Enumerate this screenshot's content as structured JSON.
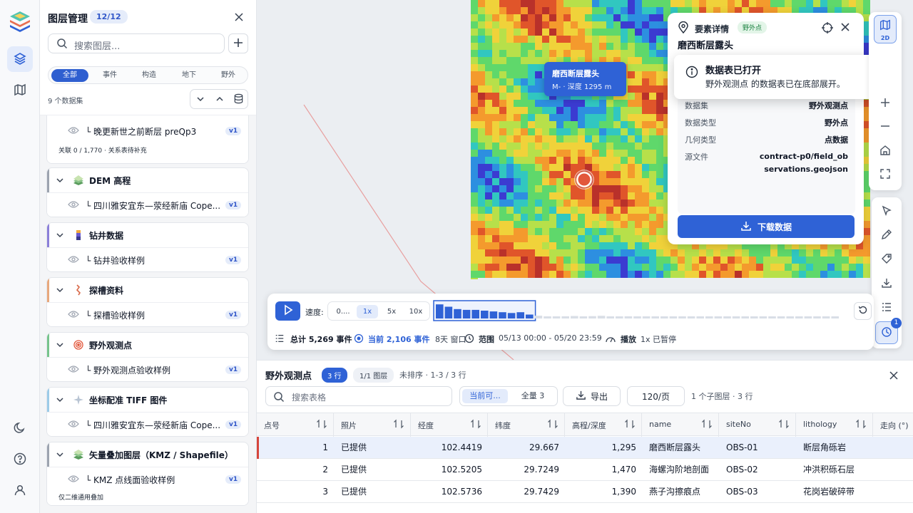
{
  "rail": {
    "items": [
      {
        "name": "layers-icon",
        "active": true
      },
      {
        "name": "map-icon",
        "active": false
      },
      {
        "name": "moon-icon",
        "active": false
      },
      {
        "name": "help-icon",
        "active": false
      },
      {
        "name": "user-icon",
        "active": false
      }
    ]
  },
  "layer_panel": {
    "title": "图层管理",
    "count": "12/12",
    "search_placeholder": "搜索图层...",
    "filters": [
      "全部",
      "事件",
      "构造",
      "地下",
      "野外"
    ],
    "active_filter": "全部",
    "dataset_count": "9 个数据集",
    "partial_item": {
      "label": "└ 晚更新世之前断层 preQp3",
      "version": "v1",
      "note": "关联 0 / 1,770 · 关系表待补充"
    },
    "groups": [
      {
        "name": "DEM 高程",
        "color": "#9ca3af",
        "icon": "terrain-icon",
        "item": {
          "label": "└ 四川雅安宜东—荥经新庙 Cope...",
          "version": "v1"
        }
      },
      {
        "name": "钻井数据",
        "color": "#8b7fd9",
        "icon": "borehole-icon",
        "item": {
          "label": "└ 钻井验收样例",
          "version": "v1"
        }
      },
      {
        "name": "探槽资料",
        "color": "#e8a87c",
        "icon": "trench-icon",
        "item": {
          "label": "└ 探槽验收样例",
          "version": "v1"
        }
      },
      {
        "name": "野外观测点",
        "color": "#76c48b",
        "icon": "target-icon",
        "item": {
          "label": "└ 野外观测点验收样例",
          "version": "v1"
        }
      },
      {
        "name": "坐标配准 TIFF 图件",
        "color": "#9ccbe8",
        "icon": "sparkle-icon",
        "item": {
          "label": "└ 四川雅安宜东—荥经新庙 Cope...",
          "version": "v1"
        }
      },
      {
        "name": "矢量叠加图层（KMZ / Shapefile）",
        "color": "#9ca3af",
        "icon": "stack-icon",
        "item": {
          "label": "└ KMZ 点线面验收样例",
          "version": "v1",
          "note": "仅二维通用叠加"
        }
      }
    ]
  },
  "map": {
    "tooltip": {
      "title": "磨西断层露头",
      "subtitle": "M- · 深度 1295 m"
    },
    "marker_color": "#e2573b"
  },
  "feature_panel": {
    "title": "要素详情",
    "tag": "野外点",
    "name": "磨西断层露头",
    "rows": [
      {
        "k": "数据集",
        "v": "野外观测点"
      },
      {
        "k": "数据类型",
        "v": "野外点"
      },
      {
        "k": "几何类型",
        "v": "点数据"
      },
      {
        "k": "源文件",
        "v": "contract-p0/field_observations.geojson"
      }
    ],
    "download_label": "下载数据"
  },
  "toast": {
    "title": "数据表已打开",
    "message": "野外观测点 的数据表已在底部展开。"
  },
  "tools": {
    "view_mode": "2D",
    "history_badge": "1"
  },
  "timeline": {
    "speed_label": "速度:",
    "speeds": [
      "0....",
      "1x",
      "5x",
      "10x"
    ],
    "active_speed": "1x",
    "total": "总计 5,269 事件",
    "current": "当前 2,106 事件",
    "window": "8天 窗口",
    "range_label": "范围",
    "range": "05/13 00:00 - 05/20 23:59",
    "play_label": "播放",
    "play_state": "1x 已暂停",
    "histogram": [
      0.9,
      0.75,
      0.6,
      0.55,
      0.55,
      0.5,
      0.45,
      0.4,
      0.35,
      0.4,
      0.25,
      0.18,
      0.1,
      0.12,
      0.14,
      0.16,
      0.12,
      0.15,
      0.17,
      0.13,
      0.12,
      0.14,
      0.11,
      0.13,
      0.1,
      0.12,
      0.11,
      0.1,
      0.12,
      0.1,
      0.09,
      0.1,
      0.11,
      0.09,
      0.1,
      0.1,
      0.09,
      0.1,
      0.11,
      0.1,
      0.09,
      0.1,
      0.1,
      0.11,
      0.1
    ],
    "selected_bins": 11
  },
  "table": {
    "title": "野外观测点",
    "rows_badge": "3 行",
    "layer_badge": "1/1 图层",
    "sort_info": "未排序 · 1-3 / 3 行",
    "search_placeholder": "搜索表格",
    "scope_current": "当前可...",
    "scope_all": "全量 3",
    "export_label": "导出",
    "page_size": "120/页",
    "sub_info": "1 个子图层 · 3 行",
    "columns": [
      "点号",
      "照片",
      "经度",
      "纬度",
      "高程/深度",
      "name",
      "siteNo",
      "lithology",
      "走向 (°)"
    ],
    "rows": [
      [
        "1",
        "已提供",
        "102.4419",
        "29.667",
        "1,295",
        "磨西断层露头",
        "OBS-01",
        "断层角砾岩"
      ],
      [
        "2",
        "已提供",
        "102.5205",
        "29.7249",
        "1,470",
        "海螺沟阶地剖面",
        "OBS-02",
        "冲洪积砾石层"
      ],
      [
        "3",
        "已提供",
        "102.5736",
        "29.7429",
        "1,390",
        "燕子沟擦痕点",
        "OBS-03",
        "花岗岩破碎带"
      ]
    ]
  }
}
